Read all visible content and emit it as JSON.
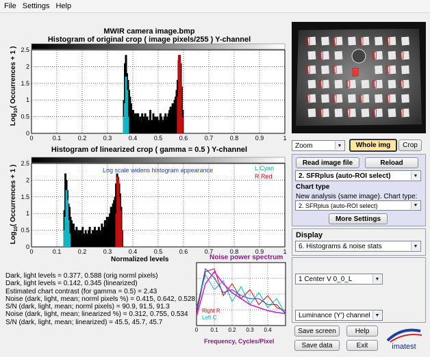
{
  "menu": [
    "File",
    "Settings",
    "Help"
  ],
  "top_hist": {
    "title1": "MWIR camera image.bmp",
    "title2": "Histogram of original crop ( image pixels/255 )  Y-channel",
    "ylabel": "Log10( Occurrences + 1 )"
  },
  "bottom_hist": {
    "title": "Histogram of linearized crop ( gamma = 0.5 )  Y-channel",
    "ylabel": "Log10( Occurrences + 1 )",
    "xlabel": "Normalized levels",
    "annotation": "Log scale widens histogram appearance",
    "legend_cyan": "L Cyan",
    "legend_red": "R  Red"
  },
  "stats": [
    "Dark, light levels = 0.377, 0.588 (orig norml pixels)",
    "Dark, light levels = 0.142, 0.345 (linearized)",
    "Estimated chart contrast (for gamma = 0.5) = 2.43",
    "Noise (dark, light, mean; norml pixels %) = 0.415,  0.642,  0.528",
    "S/N    (dark, light, mean; norml pixels)  =      90.9, 91.5, 91.3",
    "Noise (dark, light, mean; linearized %) = 0.312,  0.755,  0.534",
    "S/N    (dark, light, mean; linearized)    =      45.5, 45.7, 45.7"
  ],
  "noise_plot": {
    "title": "Noise power spectrum",
    "xlabel": "Frequency, Cycles/Pixel",
    "legend_right": "Right R",
    "legend_left": "Left  C"
  },
  "controls": {
    "zoom_select": "Zoom",
    "whole_img": "Whole img",
    "crop": "Crop",
    "read_image_file": "Read image file",
    "reload": "Reload",
    "analysis_select": "2.  SFRplus (auto-ROI select)",
    "chart_type_heading": "Chart type",
    "chart_type_text": "New analysis (same image). Chart type:",
    "chart_type_select": "2. SFRplus (auto-ROI select)",
    "more_settings": "More Settings",
    "display_heading": "Display",
    "display_select": "6.   Histograms & noise stats",
    "region_select": "1  Center  V     0_0_L",
    "channel_select": "Luminance (Y') channel",
    "save_screen": "Save screen",
    "help": "Help",
    "save_data": "Save data",
    "exit": "Exit",
    "logo_text": "imatest"
  },
  "chart_data": [
    {
      "type": "bar",
      "title": "Histogram of original crop ( image pixels/255 )  Y-channel",
      "xlabel": "",
      "ylabel": "Log10( Occurrences + 1 )",
      "xlim": [
        0,
        1
      ],
      "ylim": [
        0,
        2.5
      ],
      "series": [
        {
          "name": "Cyan",
          "x": [
            0.365,
            0.369,
            0.373,
            0.377,
            0.381
          ],
          "values": [
            0.5,
            0.9,
            1.7,
            1.3,
            0.5
          ]
        },
        {
          "name": "Red",
          "x": [
            0.578,
            0.582,
            0.586,
            0.59,
            0.594
          ],
          "values": [
            1.1,
            2.35,
            2.2,
            1.5,
            0.5
          ]
        },
        {
          "name": "Black",
          "x": [
            0.365,
            0.369,
            0.373,
            0.377,
            0.381,
            0.385,
            0.389,
            0.393,
            0.397,
            0.401,
            0.405,
            0.409,
            0.413,
            0.417,
            0.421,
            0.425,
            0.429,
            0.433,
            0.437,
            0.441,
            0.445,
            0.449,
            0.453,
            0.457,
            0.461,
            0.465,
            0.469,
            0.473,
            0.477,
            0.481,
            0.485,
            0.489,
            0.493,
            0.497,
            0.501,
            0.505,
            0.509,
            0.513,
            0.517,
            0.521,
            0.525,
            0.529,
            0.533,
            0.537,
            0.541,
            0.545,
            0.549,
            0.553,
            0.557,
            0.561,
            0.565,
            0.569,
            0.573,
            0.577,
            0.581,
            0.585,
            0.589,
            0.593,
            0.597
          ],
          "values": [
            1.0,
            2.1,
            2.35,
            1.8,
            1.6,
            1.3,
            1.1,
            0.9,
            0.7,
            0.7,
            0.5,
            0.6,
            0.4,
            0.6,
            0.6,
            0.4,
            0.5,
            0.3,
            0.6,
            0.5,
            0.4,
            0.6,
            0.3,
            0.5,
            0.3,
            0.4,
            0.7,
            0.4,
            0.3,
            0.6,
            0.3,
            0.5,
            0.4,
            0.5,
            0.4,
            0.3,
            0.6,
            0.5,
            0.3,
            0.4,
            0.5,
            0.6,
            0.4,
            0.5,
            0.6,
            0.7,
            0.8,
            0.6,
            0.9,
            0.8,
            1.0,
            1.1,
            1.3,
            1.6,
            2.2,
            2.35,
            2.1,
            1.4,
            0.7
          ]
        }
      ],
      "grid": true
    },
    {
      "type": "bar",
      "title": "Histogram of linearized crop ( gamma = 0.5 )  Y-channel",
      "xlabel": "Normalized levels",
      "ylabel": "Log10( Occurrences + 1 )",
      "xlim": [
        0,
        1
      ],
      "ylim": [
        0,
        2.5
      ],
      "series": [
        {
          "name": "Cyan",
          "x": [
            0.13,
            0.134,
            0.138,
            0.142,
            0.146,
            0.15
          ],
          "values": [
            0.5,
            0.9,
            1.7,
            1.4,
            0.8,
            0.4
          ]
        },
        {
          "name": "Red",
          "x": [
            0.335,
            0.339,
            0.343,
            0.347,
            0.351,
            0.355
          ],
          "values": [
            1.0,
            2.1,
            2.0,
            1.5,
            1.1,
            0.5
          ]
        },
        {
          "name": "Black",
          "x": [
            0.13,
            0.134,
            0.138,
            0.142,
            0.146,
            0.15,
            0.154,
            0.158,
            0.162,
            0.166,
            0.17,
            0.174,
            0.178,
            0.182,
            0.186,
            0.19,
            0.194,
            0.198,
            0.202,
            0.206,
            0.21,
            0.214,
            0.218,
            0.222,
            0.226,
            0.23,
            0.234,
            0.238,
            0.242,
            0.246,
            0.25,
            0.254,
            0.258,
            0.262,
            0.266,
            0.27,
            0.274,
            0.278,
            0.282,
            0.286,
            0.29,
            0.294,
            0.298,
            0.302,
            0.306,
            0.31,
            0.314,
            0.318,
            0.322,
            0.326,
            0.33,
            0.334,
            0.338,
            0.342,
            0.346,
            0.35,
            0.354,
            0.358
          ],
          "values": [
            1.1,
            2.2,
            2.0,
            1.7,
            1.3,
            1.2,
            0.9,
            0.8,
            0.6,
            0.7,
            0.5,
            0.4,
            0.6,
            0.3,
            0.5,
            0.4,
            0.5,
            0.3,
            0.6,
            0.4,
            0.3,
            0.5,
            0.4,
            0.3,
            0.5,
            0.6,
            0.3,
            0.4,
            0.5,
            0.3,
            0.6,
            0.4,
            0.5,
            0.3,
            0.6,
            0.5,
            0.4,
            0.7,
            0.5,
            0.6,
            0.8,
            0.6,
            0.9,
            0.7,
            0.9,
            1.0,
            1.2,
            1.1,
            1.3,
            1.4,
            1.5,
            1.9,
            2.2,
            2.1,
            1.9,
            1.6,
            1.2,
            0.5
          ]
        }
      ],
      "grid": true
    },
    {
      "type": "line",
      "title": "Noise power spectrum",
      "xlabel": "Frequency, Cycles/Pixel",
      "ylabel": "",
      "xlim": [
        0,
        0.5
      ],
      "series": [
        {
          "name": "Right R",
          "x": [
            0,
            0.05,
            0.1,
            0.15,
            0.2,
            0.25,
            0.3,
            0.35,
            0.4,
            0.45,
            0.5
          ],
          "values": [
            0.2,
            0.9,
            0.95,
            0.5,
            0.7,
            0.45,
            0.6,
            0.35,
            0.5,
            0.3,
            0.25
          ]
        },
        {
          "name": "Left  C",
          "x": [
            0,
            0.05,
            0.1,
            0.15,
            0.2,
            0.25,
            0.3,
            0.35,
            0.4,
            0.45,
            0.5
          ],
          "values": [
            0.3,
            0.85,
            0.6,
            0.75,
            0.4,
            0.65,
            0.35,
            0.55,
            0.3,
            0.45,
            0.2
          ]
        },
        {
          "name": "",
          "x": [
            0,
            0.05,
            0.1,
            0.15,
            0.2,
            0.25,
            0.3,
            0.35,
            0.4,
            0.45,
            0.5
          ],
          "values": [
            0.25,
            0.95,
            0.8,
            0.55,
            0.6,
            0.5,
            0.45,
            0.45,
            0.35,
            0.35,
            0.2
          ]
        },
        {
          "name": "",
          "x": [
            0,
            0.05,
            0.1,
            0.15,
            0.2,
            0.25,
            0.3,
            0.35,
            0.4,
            0.45,
            0.5
          ],
          "values": [
            0.15,
            0.7,
            0.9,
            0.7,
            0.55,
            0.45,
            0.35,
            0.3,
            0.25,
            0.22,
            0.2
          ]
        }
      ],
      "grid": true
    }
  ]
}
